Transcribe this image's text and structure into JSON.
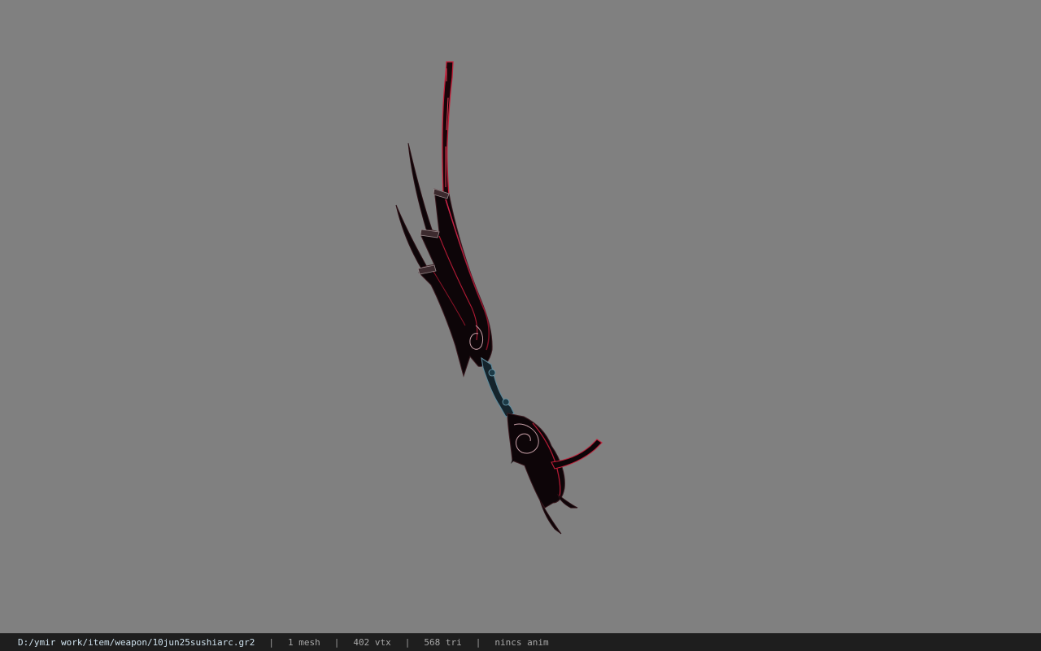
{
  "viewport": {
    "background": "#808080",
    "model": {
      "icon": "sword-weapon-model",
      "colors": {
        "body": "#0d0508",
        "edge": "#c2203a",
        "trim": "#6d8fa0"
      }
    }
  },
  "statusbar": {
    "file_path": "D:/ymir work/item/weapon/10jun25sushiarc.gr2",
    "separator": "|",
    "mesh_count": "1 mesh",
    "vertex_count": "402 vtx",
    "triangle_count": "568 tri",
    "animation": "nincs anim"
  }
}
